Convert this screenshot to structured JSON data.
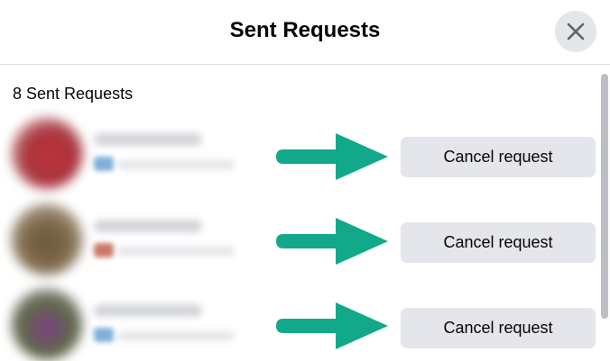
{
  "dialog": {
    "title": "Sent Requests",
    "close_icon": "close-icon",
    "count_label": "8 Sent Requests"
  },
  "requests": [
    {
      "cancel_label": "Cancel request",
      "avatar_color": "#b3343c",
      "badge_color": "#7fb0d8"
    },
    {
      "cancel_label": "Cancel request",
      "avatar_color": "#6b5a3a",
      "badge_color": "#c97a6a"
    },
    {
      "cancel_label": "Cancel request",
      "avatar_color": "#7a3f86",
      "badge_color": "#7fb0d8"
    }
  ],
  "colors": {
    "arrow": "#12a98b",
    "button_bg": "#e4e6eb",
    "divider": "#dadde1",
    "scroll_thumb": "#bcc0c4"
  }
}
